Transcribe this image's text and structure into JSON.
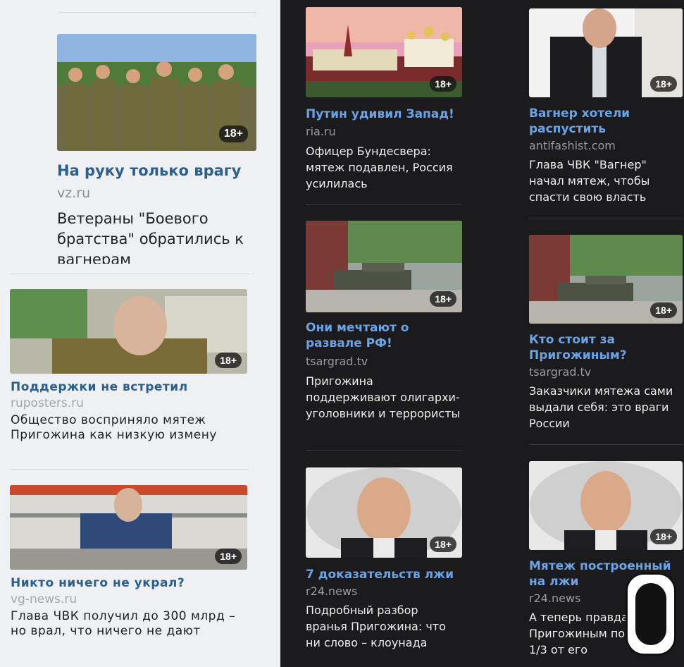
{
  "badge_label": "18+",
  "left_feed": [
    {
      "headline": "На руку только врагу",
      "source": "vz.ru",
      "description": "Ветераны \"Боевого братства\" обратились к вагнерам"
    },
    {
      "headline": "Поддержки не встретил",
      "source": "ruposters.ru",
      "description": "Общество восприняло мятеж Пригожина как низкую измену"
    },
    {
      "headline": "Никто ничего не украл?",
      "source": "vg-news.ru",
      "description": "Глава ЧВК получил до 300 млрд – но врал, что ничего не дают"
    }
  ],
  "middle_feed": [
    {
      "headline": "Путин удивил Запад!",
      "source": "ria.ru",
      "description": "Офицер Бундесвера: мятеж подавлен, Россия усилилась"
    },
    {
      "headline": "Они мечтают о развале РФ!",
      "source": "tsargrad.tv",
      "description": "Пригожина поддерживают олигархи-уголовники и террористы"
    },
    {
      "headline": "7 доказательств лжи",
      "source": "r24.news",
      "description": "Подробный разбор вранья Пригожина: что ни слово – клоунада"
    }
  ],
  "right_feed": [
    {
      "headline": "Вагнер хотели распустить",
      "source": "antifashist.com",
      "description": "Глава ЧВК \"Вагнер\" начал мятеж, чтобы спасти свою власть"
    },
    {
      "headline": "Кто стоит за Пригожиным?",
      "source": "tsargrad.tv",
      "description": "Заказчики мятежа сами выдали себя: это враги России"
    },
    {
      "headline": "Мятеж построенный на лжи",
      "source": "r24.news",
      "description": "А теперь правда за Пригожиным по менее 1/3 от его"
    }
  ],
  "colors": {
    "left_bg": "#eef0f3",
    "right_bg": "#1b1b1d",
    "link_light": "#2b5f8e",
    "link_dark": "#6aa3e6"
  }
}
